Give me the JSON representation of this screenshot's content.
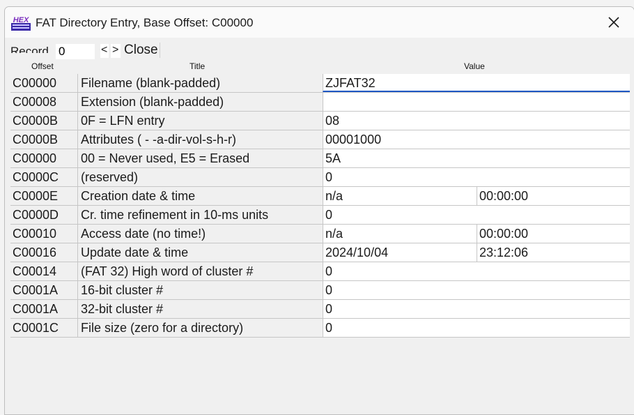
{
  "window": {
    "title": "FAT Directory Entry, Base Offset: C00000",
    "icon_text": "HEX"
  },
  "toolbar": {
    "record_label": "Record",
    "record_value": "0",
    "prev_label": "<",
    "next_label": ">",
    "close_label": "Close"
  },
  "columns": {
    "offset": "Offset",
    "title": "Title",
    "value": "Value"
  },
  "rows": [
    {
      "offset": "C00000",
      "title": "Filename (blank-padded)",
      "value": "ZJFAT32"
    },
    {
      "offset": "C00008",
      "title": "Extension (blank-padded)",
      "value": ""
    },
    {
      "offset": "C0000B",
      "title": "0F = LFN entry",
      "value": "08"
    },
    {
      "offset": "C0000B",
      "title": "Attributes ( - -a-dir-vol-s-h-r)",
      "value": "00001000"
    },
    {
      "offset": "C00000",
      "title": "00 = Never used, E5 = Erased",
      "value": "5A"
    },
    {
      "offset": "C0000C",
      "title": "(reserved)",
      "value": "0"
    },
    {
      "offset": "C0000E",
      "title": "Creation date & time",
      "value": "n/a",
      "value2": "00:00:00"
    },
    {
      "offset": "C0000D",
      "title": "Cr. time refinement in 10-ms units",
      "value": "0"
    },
    {
      "offset": "C00010",
      "title": "Access date (no time!)",
      "value": "n/a",
      "value2": "00:00:00"
    },
    {
      "offset": "C00016",
      "title": "Update date & time",
      "value": "2024/10/04",
      "value2": "23:12:06"
    },
    {
      "offset": "C00014",
      "title": "(FAT 32) High word of cluster #",
      "value": "0"
    },
    {
      "offset": "C0001A",
      "title": "16-bit cluster #",
      "value": "0"
    },
    {
      "offset": "C0001A",
      "title": "32-bit cluster #",
      "value": "0"
    },
    {
      "offset": "C0001C",
      "title": "File size (zero for a directory)",
      "value": "0"
    }
  ]
}
